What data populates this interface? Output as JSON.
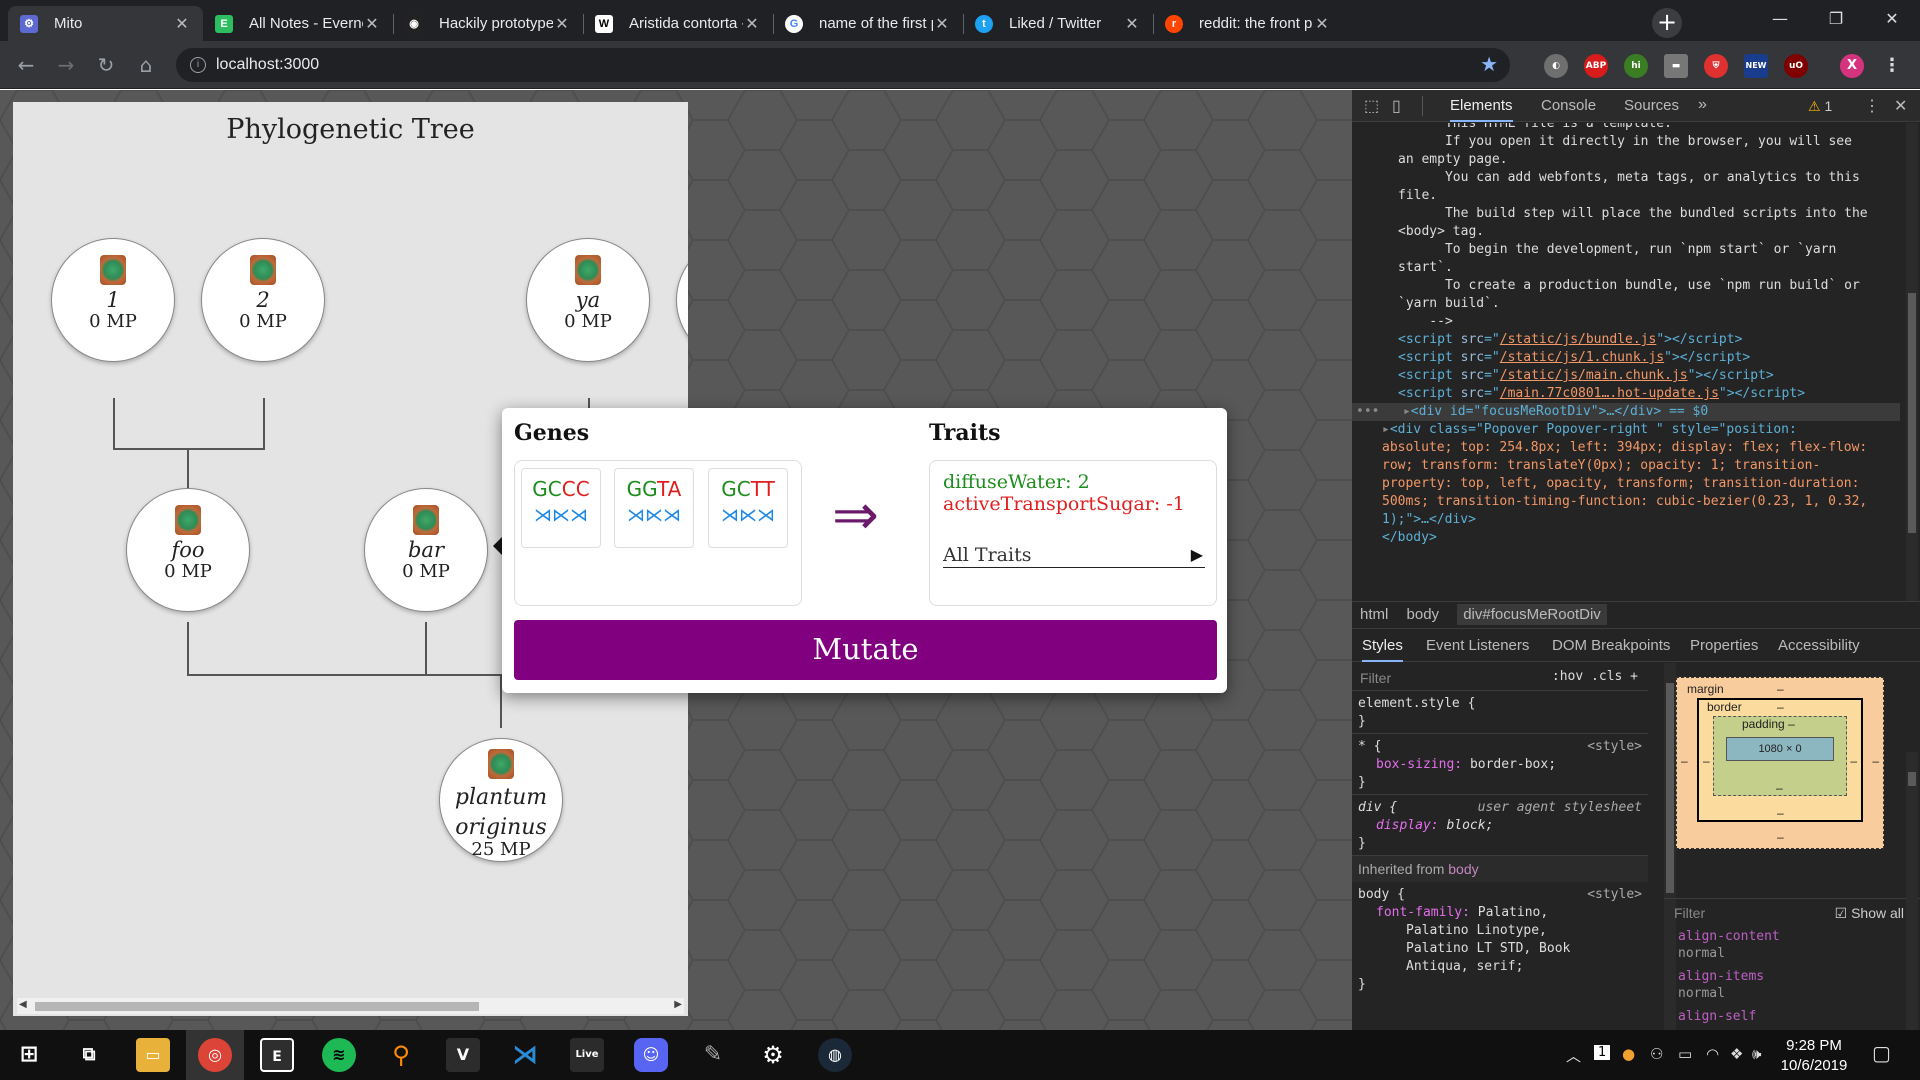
{
  "browser": {
    "tabs": [
      {
        "title": "Mito",
        "color": "#5e6ad2",
        "glyph": "⚙"
      },
      {
        "title": "All Notes - Evernote W",
        "color": "#2dbe60",
        "glyph": "E"
      },
      {
        "title": "Hackily prototype Trait",
        "color": "#222222",
        "glyph": "◉"
      },
      {
        "title": "Aristida contorta - Wik",
        "color": "#ffffff",
        "glyph": "W"
      },
      {
        "title": "name of the first plant",
        "color": "#4285f4",
        "glyph": "G"
      },
      {
        "title": "Liked / Twitter",
        "color": "#1da1f2",
        "glyph": "t"
      },
      {
        "title": "reddit: the front page c",
        "color": "#ff4500",
        "glyph": "r"
      }
    ],
    "url": "localhost:3000",
    "new_tab": "+",
    "extensions": [
      "ABP",
      "hi",
      "NEW",
      "uO",
      "X"
    ]
  },
  "tree": {
    "title": "Phylogenetic Tree",
    "nodes": [
      {
        "name": "1",
        "mp": "0 MP"
      },
      {
        "name": "2",
        "mp": "0 MP"
      },
      {
        "name": "ya",
        "mp": "0 MP"
      },
      {
        "name": "foo",
        "mp": "0 MP"
      },
      {
        "name": "bar",
        "mp": "0 MP"
      },
      {
        "name": "plantum originus",
        "mp": "25 MP"
      }
    ]
  },
  "popover": {
    "genes_title": "Genes",
    "traits_title": "Traits",
    "genes": [
      {
        "letters": [
          [
            "G",
            "g"
          ],
          [
            "C",
            "g"
          ],
          [
            "C",
            "r"
          ],
          [
            "C",
            "r"
          ]
        ]
      },
      {
        "letters": [
          [
            "G",
            "g"
          ],
          [
            "G",
            "g"
          ],
          [
            "T",
            "r"
          ],
          [
            "A",
            "r"
          ]
        ]
      },
      {
        "letters": [
          [
            "G",
            "g"
          ],
          [
            "C",
            "g"
          ],
          [
            "T",
            "r"
          ],
          [
            "T",
            "r"
          ]
        ]
      }
    ],
    "arrow": "⇒",
    "traits": [
      {
        "text": "diffuseWater: 2",
        "kind": "pos"
      },
      {
        "text": "activeTransportSugar: -1",
        "kind": "neg"
      }
    ],
    "all_traits": "All Traits",
    "mutate": "Mutate"
  },
  "devtools": {
    "tabs": [
      "Elements",
      "Console",
      "Sources"
    ],
    "warnings": "1",
    "code_lines": [
      {
        "t": "cm",
        "s": "      This HTML file is a template."
      },
      {
        "t": "cm",
        "s": "      If you open it directly in the browser, you will see"
      },
      {
        "t": "cm",
        "s": "an empty page."
      },
      {
        "t": "cm",
        "s": ""
      },
      {
        "t": "cm",
        "s": "      You can add webfonts, meta tags, or analytics to this"
      },
      {
        "t": "cm",
        "s": "file."
      },
      {
        "t": "cm",
        "s": "      The build step will place the bundled scripts into the"
      },
      {
        "t": "cm",
        "s": "<body> tag."
      },
      {
        "t": "cm",
        "s": ""
      },
      {
        "t": "cm",
        "s": "      To begin the development, run `npm start` or `yarn"
      },
      {
        "t": "cm",
        "s": "start`."
      },
      {
        "t": "cm",
        "s": "      To create a production bundle, use `npm run build` or"
      },
      {
        "t": "cm",
        "s": "`yarn build`."
      },
      {
        "t": "cm",
        "s": "    -->"
      }
    ],
    "scripts": [
      "/static/js/bundle.js",
      "/static/js/1.chunk.js",
      "/static/js/main.chunk.js",
      "/main.77c0801….hot-update.js"
    ],
    "selected_node": "<div id=\"focusMeRootDiv\">…</div> == $0",
    "popover_node": [
      "<div class=\"Popover Popover-right \" style=\"position:",
      "absolute; top: 254.8px; left: 394px; display: flex; flex-flow:",
      "row; transform: translateY(0px); opacity: 1; transition-",
      "property: top, left, opacity, transform; transition-duration:",
      "500ms; transition-timing-function: cubic-bezier(0.23, 1, 0.32,",
      "1);\">…</div>"
    ],
    "close_body": "</body>",
    "crumbs": [
      "html",
      "body",
      "div#focusMeRootDiv"
    ],
    "subtabs": [
      "Styles",
      "Event Listeners",
      "DOM Breakpoints",
      "Properties",
      "Accessibility"
    ],
    "filter_placeholder": "Filter",
    "filter_buttons": ":hov  .cls  +",
    "rules": {
      "element_style": "element.style {",
      "star_sel": "* {",
      "star_src": "<style>",
      "star_prop": "box-sizing",
      "star_val": "border-box;",
      "div_sel": "div {",
      "div_src": "user agent stylesheet",
      "div_prop": "display",
      "div_val": "block;",
      "inherited_label": "Inherited from",
      "inherited_from": "body",
      "body_sel": "body {",
      "body_src": "<style>",
      "body_prop": "font-family",
      "body_val": "Palatino,",
      "body_val2": "Palatino Linotype,",
      "body_val3": "Palatino LT STD, Book",
      "body_val4": "Antiqua, serif;"
    },
    "boxmodel": {
      "margin": "margin",
      "border": "border",
      "padding": "padding",
      "content": "1080 × 0",
      "dash": "–"
    },
    "computed_filter": "Filter",
    "show_all": "Show all",
    "computed": [
      {
        "name": "align-content",
        "value": "normal"
      },
      {
        "name": "align-items",
        "value": "normal"
      },
      {
        "name": "align-self",
        "value": ""
      }
    ]
  },
  "taskbar": {
    "time": "9:28 PM",
    "date": "10/6/2019",
    "badge": "1"
  }
}
